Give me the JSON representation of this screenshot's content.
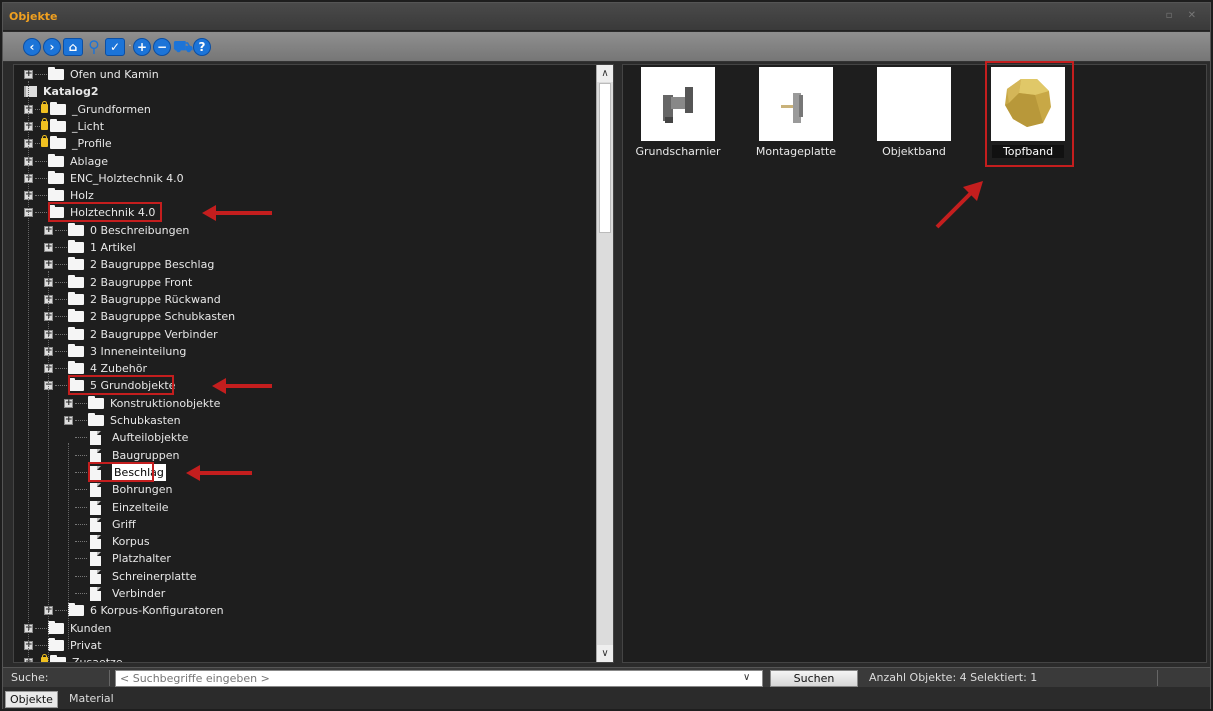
{
  "window": {
    "title": "Objekte",
    "title_buttons": "▫ ✕"
  },
  "toolbar": {
    "icons": [
      "back-icon",
      "forward-icon",
      "home-icon",
      "search-icon",
      "check-icon",
      "add-icon",
      "remove-icon",
      "cart-icon",
      "help-icon"
    ]
  },
  "tree": {
    "nodes": [
      {
        "label": "Ofen und Kamin",
        "level": 0,
        "type": "folder",
        "expander": "+"
      },
      {
        "label": "Katalog2",
        "level": -1,
        "type": "catalog",
        "bold": true
      },
      {
        "label": "_Grundformen",
        "level": 0,
        "type": "folder",
        "expander": "+",
        "lock": true
      },
      {
        "label": "_Licht",
        "level": 0,
        "type": "folder",
        "expander": "+",
        "lock": true
      },
      {
        "label": "_Profile",
        "level": 0,
        "type": "folder",
        "expander": "+",
        "lock": true
      },
      {
        "label": "Ablage",
        "level": 0,
        "type": "folder",
        "expander": "+"
      },
      {
        "label": "ENC_Holztechnik 4.0",
        "level": 0,
        "type": "folder",
        "expander": "+"
      },
      {
        "label": "Holz",
        "level": 0,
        "type": "folder",
        "expander": "+"
      },
      {
        "label": "Holztechnik 4.0",
        "level": 0,
        "type": "folder",
        "expander": "-",
        "highlight": true
      },
      {
        "label": "0 Beschreibungen",
        "level": 1,
        "type": "folder",
        "expander": "+"
      },
      {
        "label": "1 Artikel",
        "level": 1,
        "type": "folder",
        "expander": "+"
      },
      {
        "label": "2 Baugruppe Beschlag",
        "level": 1,
        "type": "folder",
        "expander": "+"
      },
      {
        "label": "2 Baugruppe Front",
        "level": 1,
        "type": "folder",
        "expander": "+"
      },
      {
        "label": "2 Baugruppe Rückwand",
        "level": 1,
        "type": "folder",
        "expander": "+"
      },
      {
        "label": "2 Baugruppe Schubkasten",
        "level": 1,
        "type": "folder",
        "expander": "+"
      },
      {
        "label": "2 Baugruppe Verbinder",
        "level": 1,
        "type": "folder",
        "expander": "+"
      },
      {
        "label": "3 Inneneinteilung",
        "level": 1,
        "type": "folder",
        "expander": "+"
      },
      {
        "label": "4 Zubehör",
        "level": 1,
        "type": "folder",
        "expander": "+"
      },
      {
        "label": "5 Grundobjekte",
        "level": 1,
        "type": "folder",
        "expander": "-",
        "highlight": true
      },
      {
        "label": "Konstruktionobjekte",
        "level": 2,
        "type": "folder",
        "expander": "+"
      },
      {
        "label": "Schubkasten",
        "level": 2,
        "type": "folder",
        "expander": "+"
      },
      {
        "label": "Aufteilobjekte",
        "level": 2,
        "type": "doc"
      },
      {
        "label": "Baugruppen",
        "level": 2,
        "type": "doc"
      },
      {
        "label": "Beschlag",
        "level": 2,
        "type": "doc",
        "highlight": true,
        "selected": true
      },
      {
        "label": "Bohrungen",
        "level": 2,
        "type": "doc"
      },
      {
        "label": "Einzelteile",
        "level": 2,
        "type": "doc"
      },
      {
        "label": "Griff",
        "level": 2,
        "type": "doc"
      },
      {
        "label": "Korpus",
        "level": 2,
        "type": "doc"
      },
      {
        "label": "Platzhalter",
        "level": 2,
        "type": "doc"
      },
      {
        "label": "Schreinerplatte",
        "level": 2,
        "type": "doc"
      },
      {
        "label": "Verbinder",
        "level": 2,
        "type": "doc"
      },
      {
        "label": "6 Korpus-Konfiguratoren",
        "level": 1,
        "type": "folder",
        "expander": "+"
      },
      {
        "label": "Kunden",
        "level": 0,
        "type": "folder",
        "expander": "+"
      },
      {
        "label": "Privat",
        "level": 0,
        "type": "folder",
        "expander": "+"
      },
      {
        "label": "Zusaetze",
        "level": 0,
        "type": "folder",
        "expander": "+",
        "lock": true
      }
    ]
  },
  "objects": {
    "items": [
      {
        "caption": "Grundscharnier",
        "thumb": "hinge-icon"
      },
      {
        "caption": "Montageplatte",
        "thumb": "mounting-plate-icon"
      },
      {
        "caption": "Objektband",
        "thumb": "blank-icon"
      },
      {
        "caption": "Topfband",
        "thumb": "cup-hinge-icon",
        "selected": true
      }
    ]
  },
  "search": {
    "label": "Suche:",
    "placeholder": "< Suchbegriffe eingeben >",
    "button_label": "Suchen"
  },
  "status": {
    "text": "Anzahl Objekte: 4   Selektiert: 1"
  },
  "tabs": [
    {
      "label": "Objekte",
      "active": true
    },
    {
      "label": "Material",
      "active": false
    }
  ],
  "colors": {
    "accent_title": "#f0a020",
    "highlight_red": "#c41e1e",
    "toolbar_blue": "#1c74d8"
  }
}
